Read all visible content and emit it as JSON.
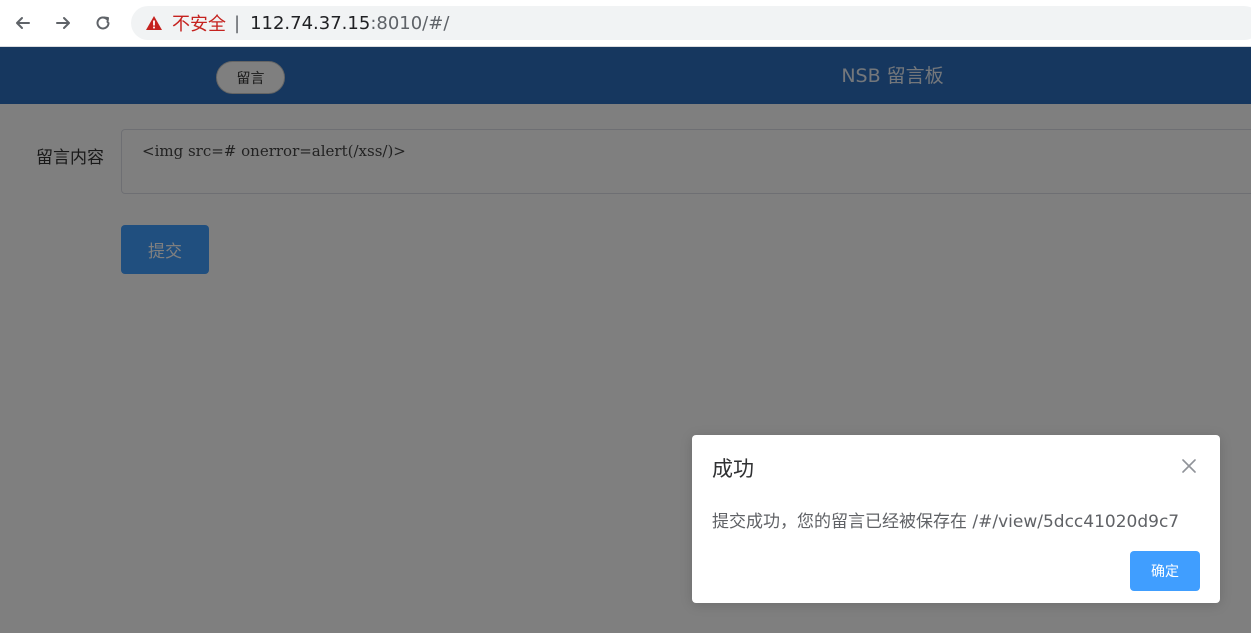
{
  "browser": {
    "insecure_label": "不安全",
    "separator": "|",
    "url_host": "112.74.37.15",
    "url_rest": ":8010/#/"
  },
  "icons": {
    "back": "back-arrow-icon",
    "forward": "forward-arrow-icon",
    "reload": "reload-icon",
    "warning": "warning-triangle-icon",
    "close": "close-icon"
  },
  "header": {
    "nav_pill": "留言",
    "title": "NSB 留言板"
  },
  "form": {
    "content_label": "留言内容",
    "content_value": "<img src=# onerror=alert(/xss/)>",
    "submit_label": "提交"
  },
  "dialog": {
    "title": "成功",
    "message": "提交成功，您的留言已经被保存在 /#/view/5dcc41020d9c7",
    "confirm_label": "确定"
  },
  "colors": {
    "header_bg": "#2d6fbe",
    "primary_button": "#409eff",
    "insecure_red": "#c5221f"
  }
}
